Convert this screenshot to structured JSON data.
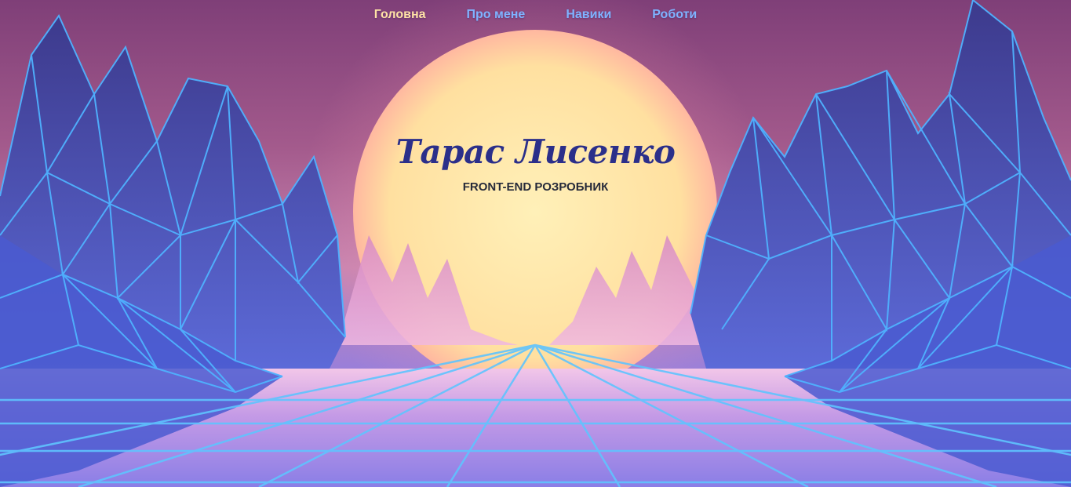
{
  "nav": {
    "items": [
      {
        "label": "Головна",
        "active": true
      },
      {
        "label": "Про мене",
        "active": false
      },
      {
        "label": "Навики",
        "active": false
      },
      {
        "label": "Роботи",
        "active": false
      }
    ]
  },
  "hero": {
    "name": "Тарас Лисенко",
    "role": "FRONT-END РОЗРОБНИК"
  },
  "colors": {
    "nav_link": "#7fb3ff",
    "nav_active": "#ffe2a6",
    "title": "#2b2f8a",
    "subtitle": "#262a3a",
    "sun": "#ffe0a0",
    "neon": "#4fb2ff"
  }
}
